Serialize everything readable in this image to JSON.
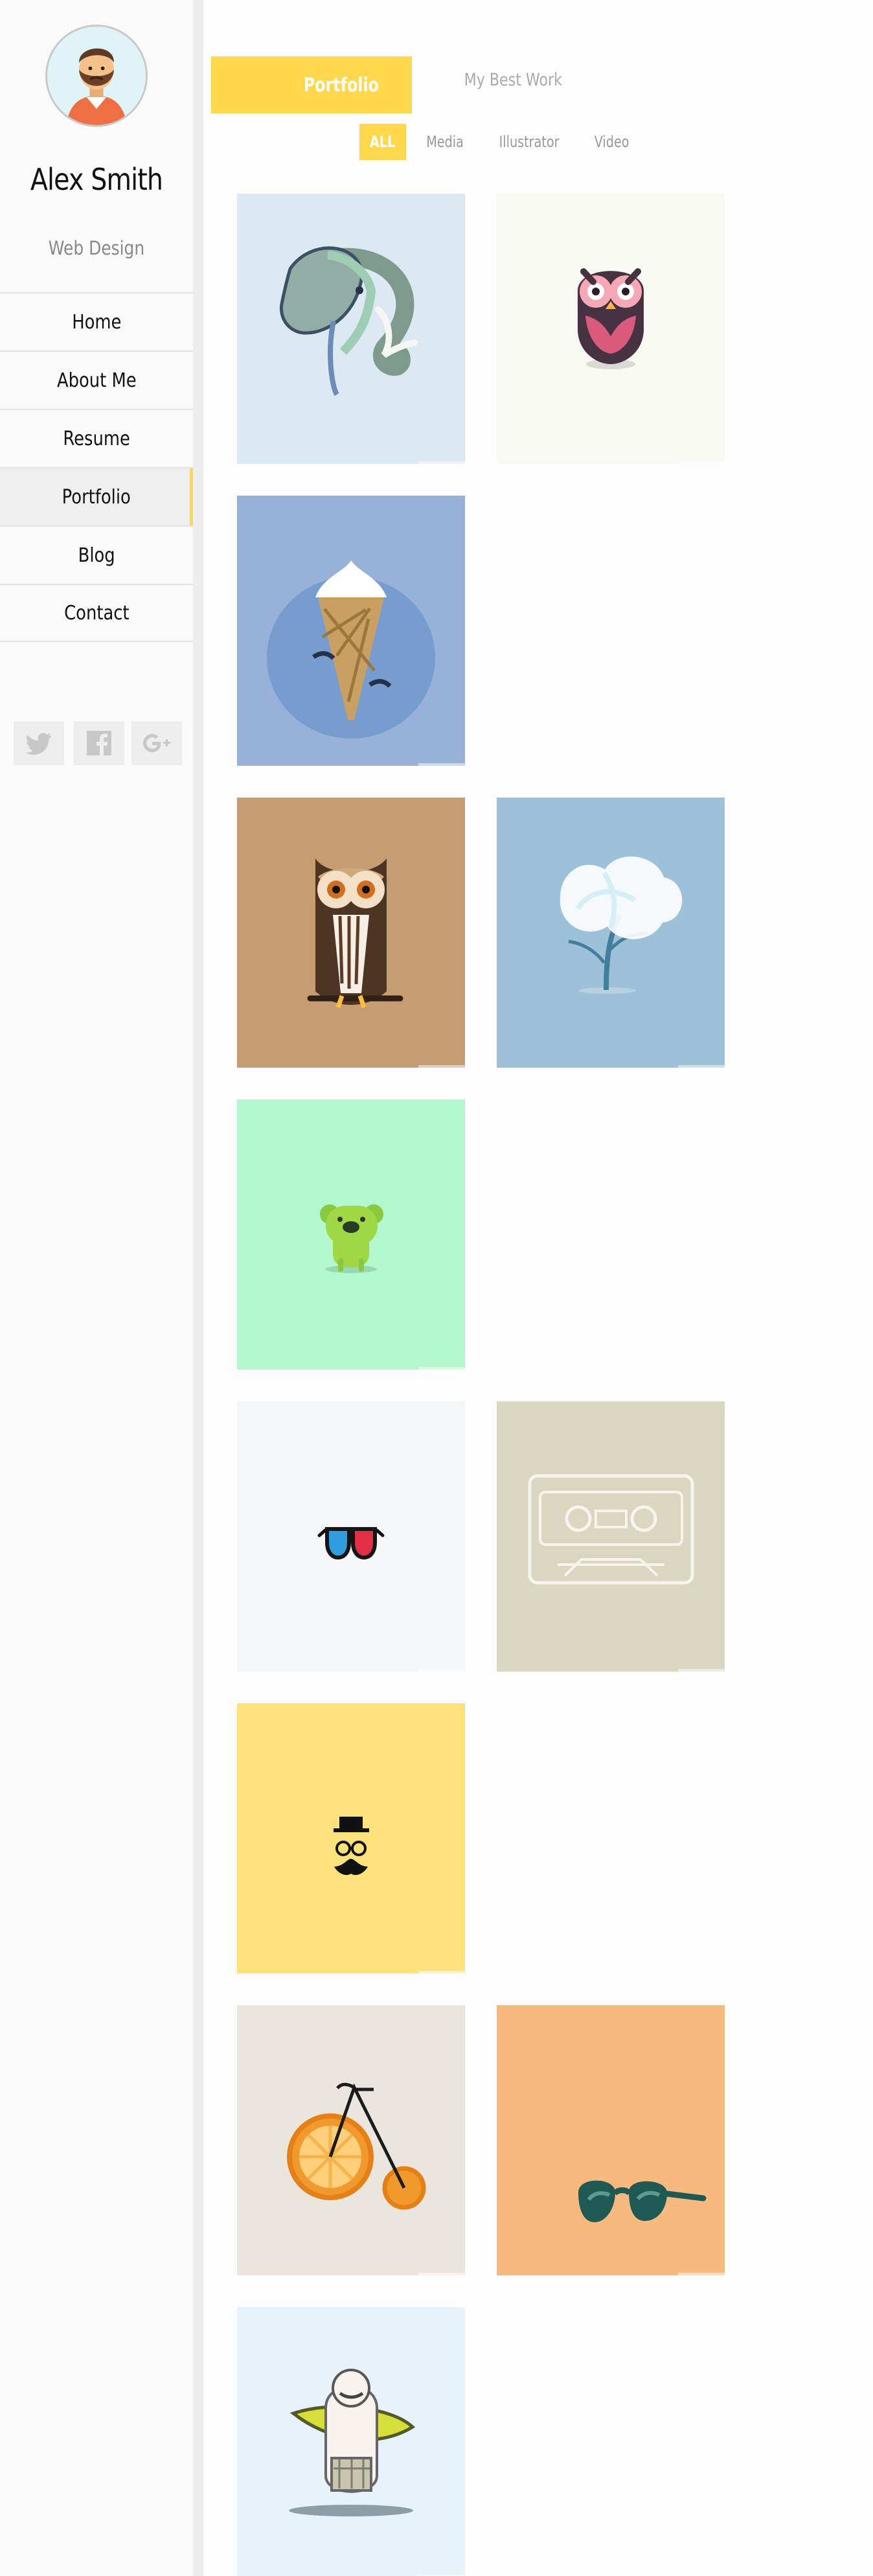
{
  "profile": {
    "name": "Alex Smith",
    "role": "Web Design"
  },
  "nav": {
    "items": [
      {
        "label": "Home"
      },
      {
        "label": "About Me"
      },
      {
        "label": "Resume"
      },
      {
        "label": "Portfolio",
        "active": true
      },
      {
        "label": "Blog"
      },
      {
        "label": "Contact"
      }
    ]
  },
  "social": [
    {
      "icon": "twitter-icon"
    },
    {
      "icon": "facebook-icon"
    },
    {
      "icon": "google-plus-icon"
    }
  ],
  "header": {
    "title": "Portfolio",
    "subtitle": "My Best Work"
  },
  "filters": {
    "items": [
      {
        "label": "ALL",
        "active": true
      },
      {
        "label": "Media"
      },
      {
        "label": "Illustrator"
      },
      {
        "label": "Video"
      }
    ]
  },
  "colors": {
    "accent": "#ffd84e",
    "sidebar_bg": "#fafafa",
    "text_muted": "#999999"
  },
  "portfolio": {
    "items": [
      {
        "icon": "elephant-icon",
        "bg": "#dde9f2"
      },
      {
        "icon": "owl-icon",
        "bg": "#f8f9f3"
      },
      {
        "icon": "ice-cream-iceberg-icon",
        "bg": "#98b1d8"
      },
      {
        "icon": "brown-owl-icon",
        "bg": "#c69c72"
      },
      {
        "icon": "tree-icon",
        "bg": "#9dc1d8"
      },
      {
        "icon": "koala-icon",
        "bg": "#b2f7cd"
      },
      {
        "icon": "3d-glasses-icon",
        "bg": "#f4f6f7"
      },
      {
        "icon": "cassette-icon",
        "bg": "#d9d7c0"
      },
      {
        "icon": "gentleman-mustache-icon",
        "bg": "#fde27c"
      },
      {
        "icon": "orange-bicycle-icon",
        "bg": "#ebe6dd"
      },
      {
        "icon": "sunglasses-icon",
        "bg": "#f8b97f"
      },
      {
        "icon": "surfer-icon",
        "bg": "#e7f2fa"
      }
    ]
  }
}
